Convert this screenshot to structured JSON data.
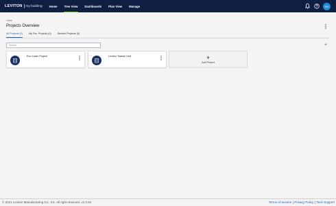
{
  "brand": {
    "name": "LEVITON",
    "product": "my building"
  },
  "nav": {
    "items": [
      {
        "label": "Home",
        "active": false
      },
      {
        "label": "Tree View",
        "active": true
      },
      {
        "label": "Dashboards",
        "active": false
      },
      {
        "label": "Plan View",
        "active": false
      },
      {
        "label": "Manage",
        "active": false
      }
    ],
    "avatar_initials": "DU",
    "icons": [
      "bell-icon",
      "help-icon"
    ]
  },
  "page": {
    "breadcrumb": "Home",
    "title": "Projects Overview"
  },
  "tabs": [
    {
      "label": "All Projects (2)",
      "active": true
    },
    {
      "label": "My Fav. Projects (0)",
      "active": false
    },
    {
      "label": "Deleted Projects (0)",
      "active": false
    }
  ],
  "search": {
    "placeholder": "Search",
    "value": ""
  },
  "projects": [
    {
      "name": "Eco Learn Project"
    },
    {
      "name": "Leviton Tsaseri Unit"
    }
  ],
  "add_project": {
    "label": "Add Project"
  },
  "footer": {
    "copyright": "© 2021 Leviton Manufacturing Co., Inc. All right reserved. v1.0.94",
    "links": [
      "Terms of Service",
      "Privacy Policy",
      "Tech Support"
    ],
    "separator": "|"
  },
  "colors": {
    "topbar": "#0f1f44",
    "active_nav_underline": "#7ed321",
    "avatar": "#1d8fd6",
    "tab_active": "#1b63b5",
    "project_logo": "#1b2f62"
  }
}
